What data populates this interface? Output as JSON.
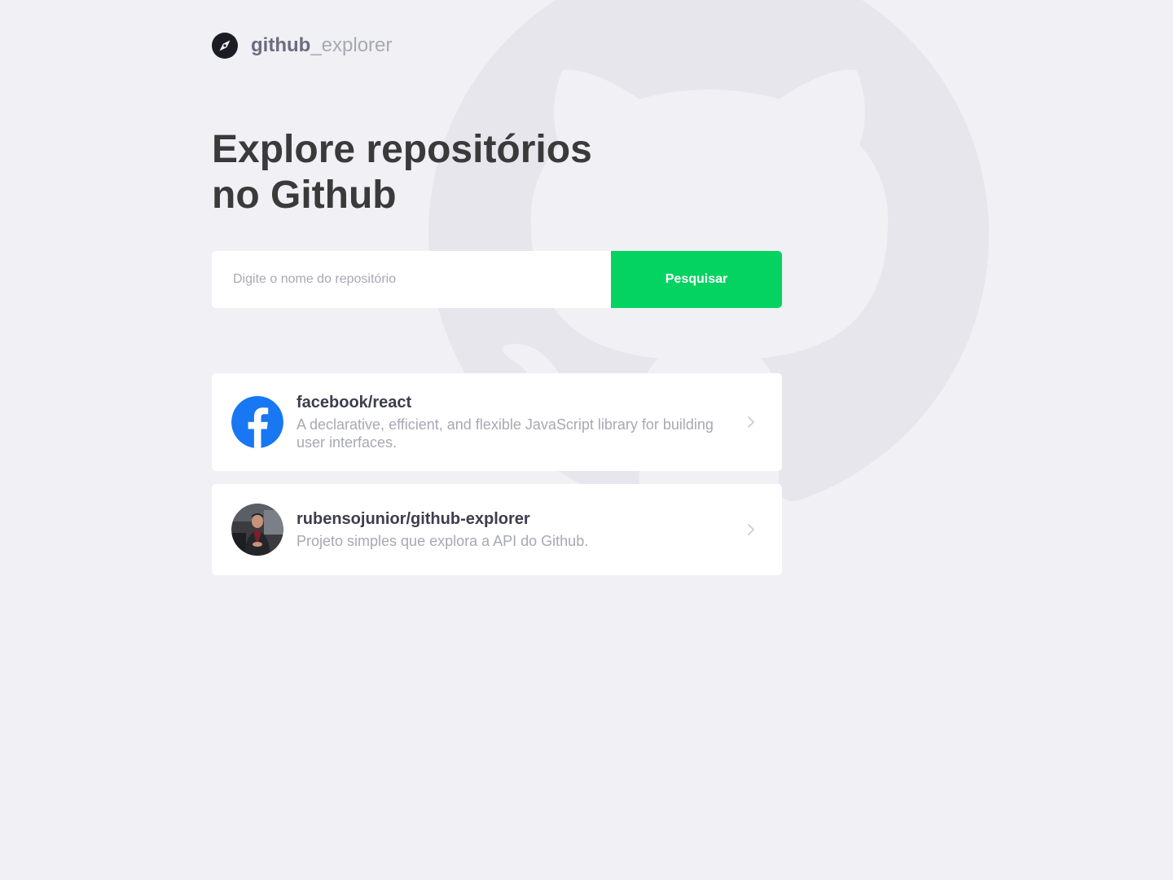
{
  "app": {
    "brand_strong": "github",
    "brand_light": "_explorer",
    "brand_icon": "compass-icon"
  },
  "hero": {
    "title_line1": "Explore repositórios",
    "title_line2": "no Github"
  },
  "search": {
    "placeholder": "Digite o nome do repositório",
    "value": "",
    "button_label": "Pesquisar"
  },
  "repositories": [
    {
      "name": "facebook/react",
      "description": "A declarative, efficient, and flexible JavaScript library for building user interfaces.",
      "avatar": "facebook-logo-icon"
    },
    {
      "name": "rubensojunior/github-explorer",
      "description": "Projeto simples que explora a API do Github.",
      "avatar": "user-avatar"
    }
  ],
  "colors": {
    "background": "#f0f0f5",
    "accent": "#04d361",
    "title": "#3a3a3a",
    "muted": "#a8a8b3",
    "facebook_blue": "#1877f2"
  }
}
